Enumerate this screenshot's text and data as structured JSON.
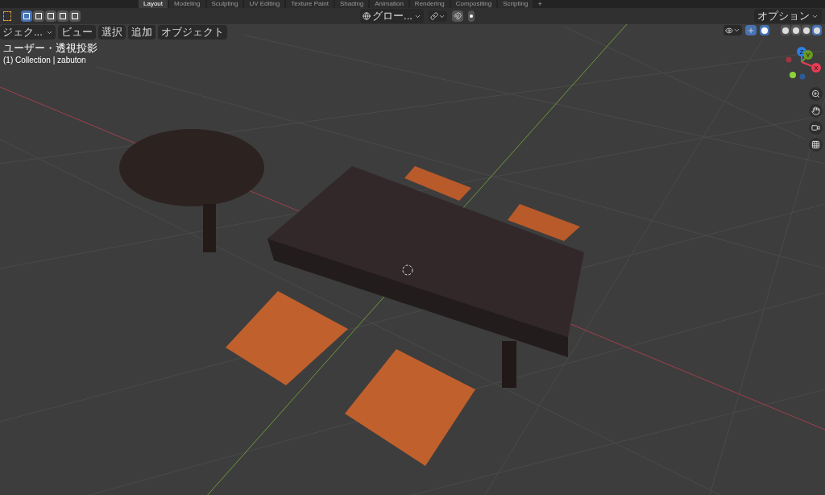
{
  "workspace_tabs": [
    {
      "label": "Layout",
      "selected": true
    },
    {
      "label": "Modeling",
      "selected": false
    },
    {
      "label": "Sculpting",
      "selected": false
    },
    {
      "label": "UV Editing",
      "selected": false
    },
    {
      "label": "Texture Paint",
      "selected": false
    },
    {
      "label": "Shading",
      "selected": false
    },
    {
      "label": "Animation",
      "selected": false
    },
    {
      "label": "Rendering",
      "selected": false
    },
    {
      "label": "Compositing",
      "selected": false
    },
    {
      "label": "Scripting",
      "selected": false
    }
  ],
  "add_tab": "+",
  "select_modes": [
    {
      "selected": true
    },
    {
      "selected": false
    },
    {
      "selected": false
    },
    {
      "selected": false
    },
    {
      "selected": false
    }
  ],
  "transform_orientation": "グロー...",
  "options_button": "オプション",
  "shading_modes": [
    {
      "selected": false
    },
    {
      "selected": false
    },
    {
      "selected": false
    },
    {
      "selected": true
    }
  ],
  "mode_dropdown": "ジェク...",
  "menus": [
    "ビュー",
    "選択",
    "追加",
    "オブジェクト"
  ],
  "viewport": {
    "view_name": "ユーザー・透視投影",
    "collection_info": "(1) Collection | zabuton"
  },
  "gizmo_axes": [
    {
      "label": "Z",
      "color": "#2f7de1"
    },
    {
      "label": "Y",
      "color": "#6a9a1f"
    },
    {
      "label": "X",
      "color": "#e83c55"
    }
  ]
}
